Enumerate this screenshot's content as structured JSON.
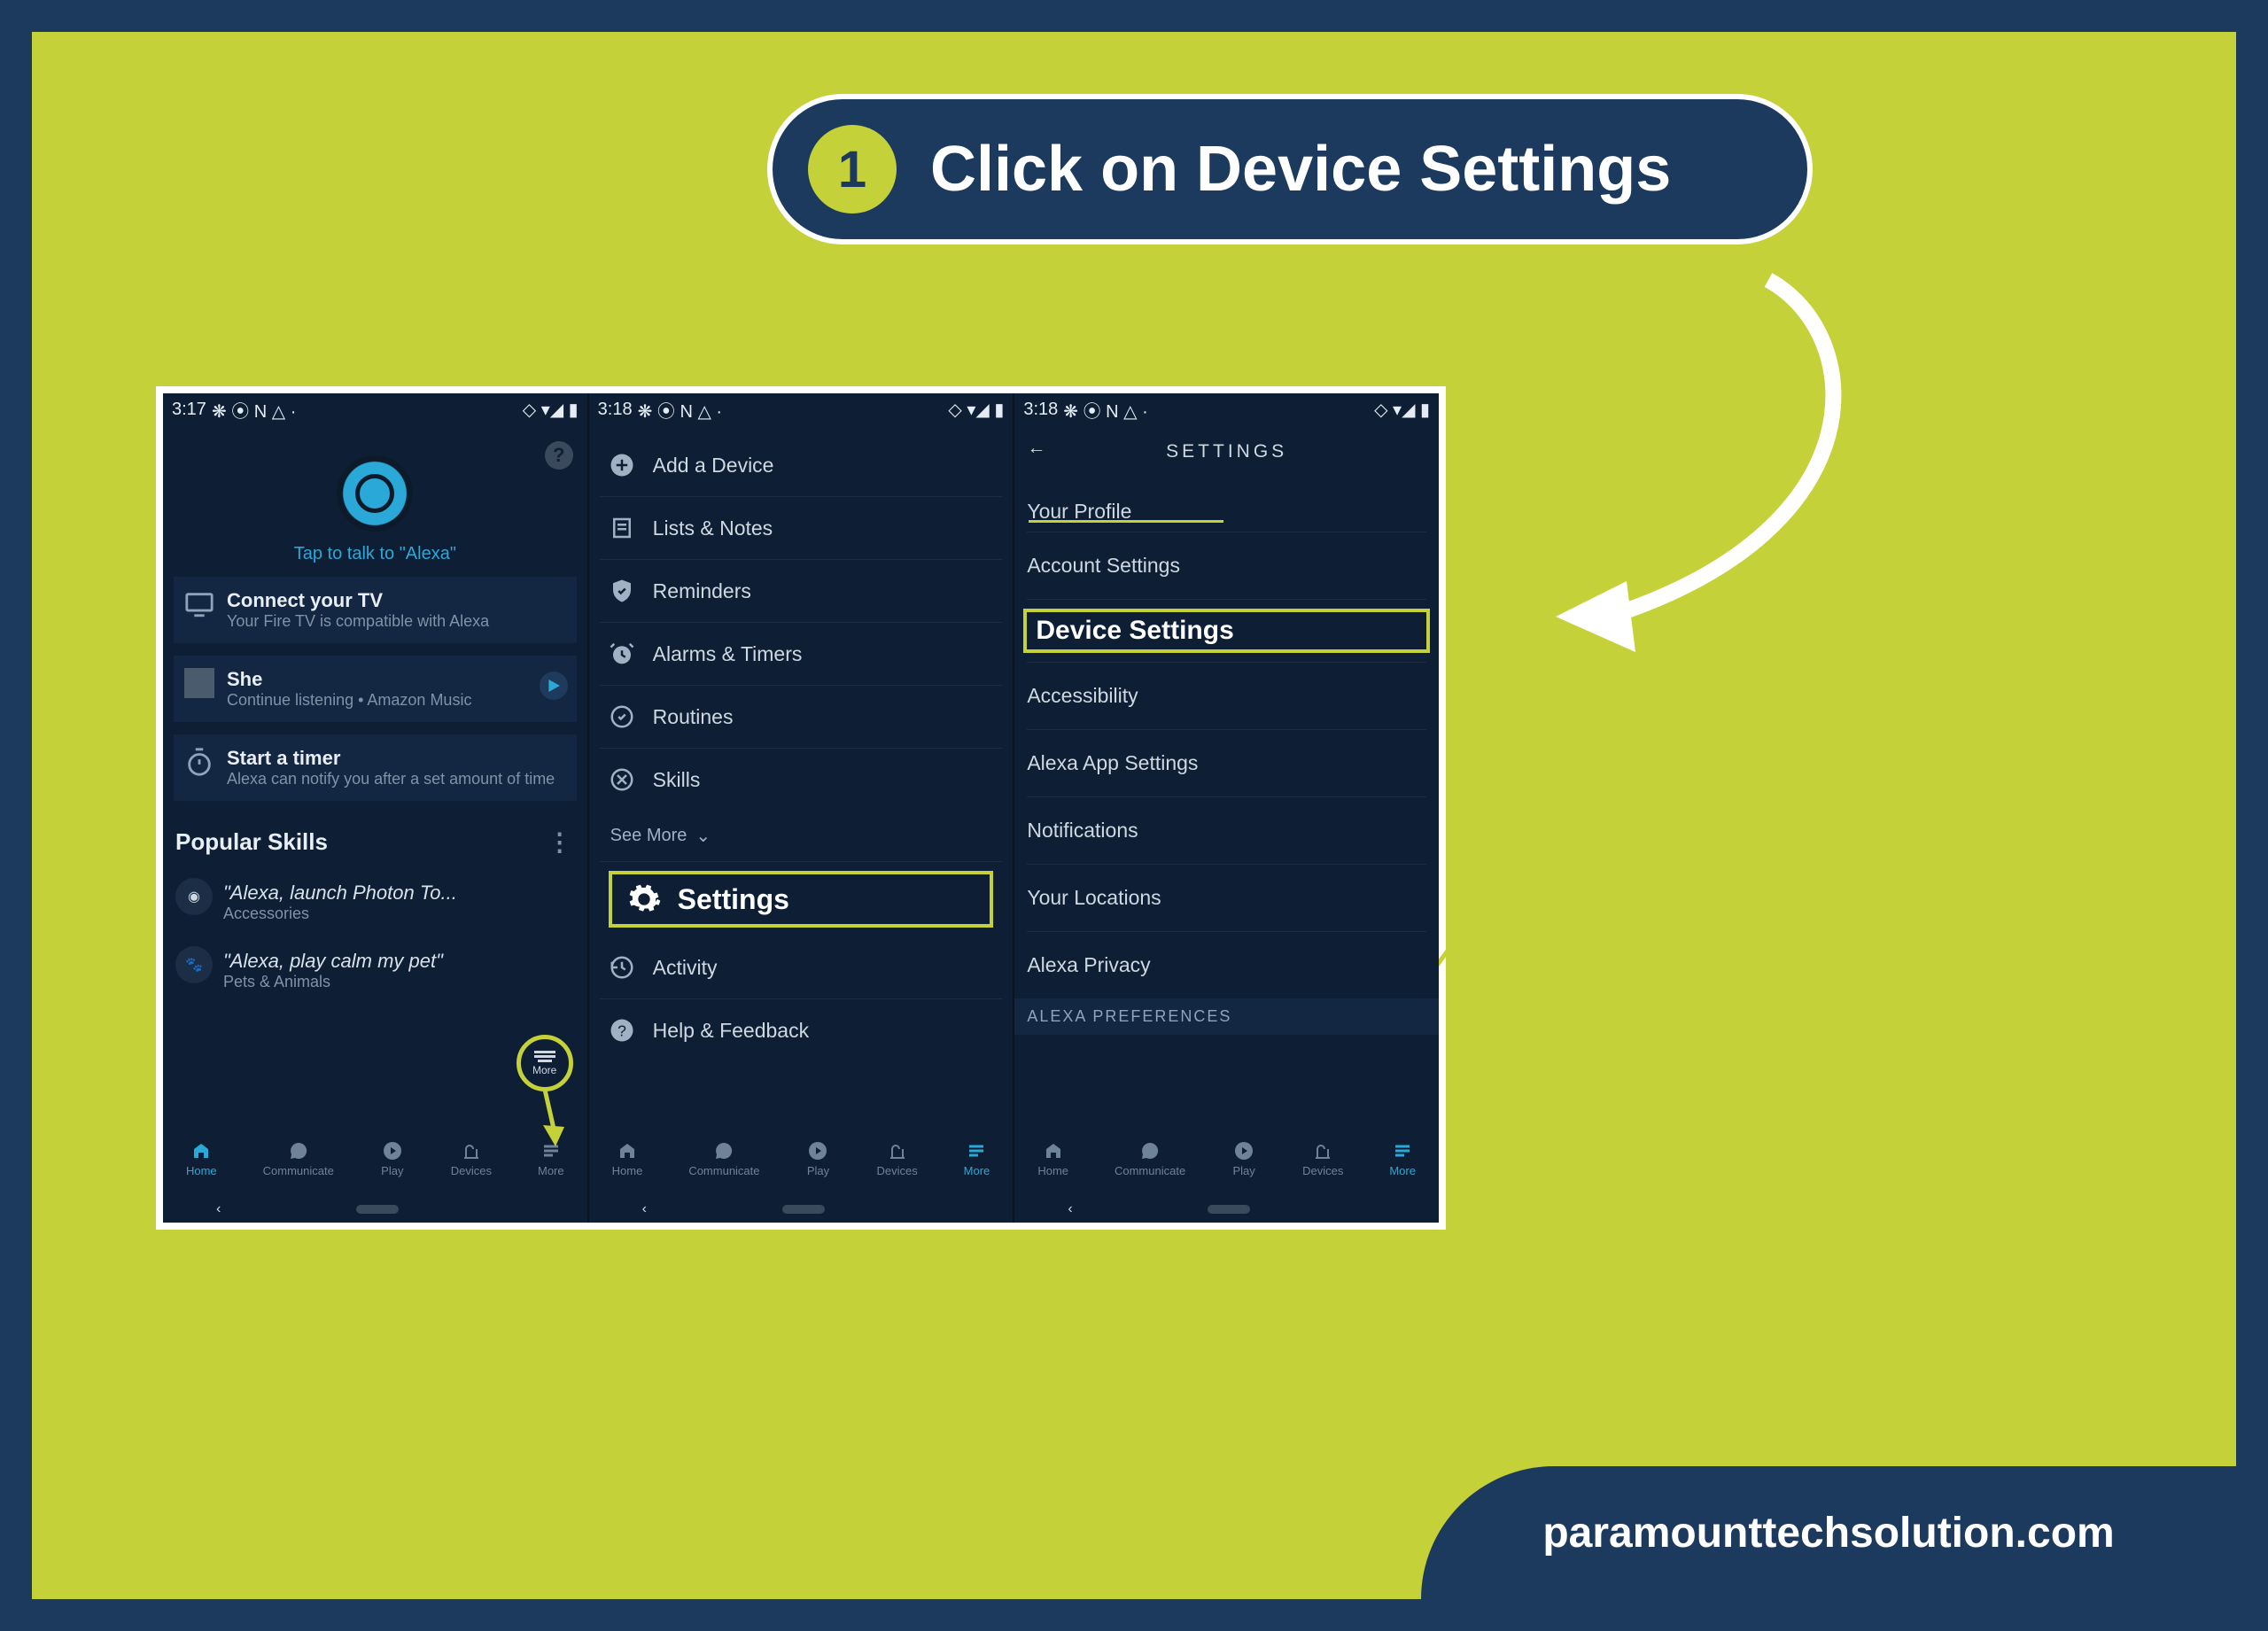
{
  "callout": {
    "step_number": "1",
    "text": "Click on Device Settings"
  },
  "website": "paramounttechsolution.com",
  "screen1": {
    "time": "3:17",
    "status_icons": "❋ ⦿ N △ ·",
    "tap_talk": "Tap to talk to \"Alexa\"",
    "connect": {
      "title": "Connect your TV",
      "sub": "Your Fire TV is compatible with Alexa"
    },
    "she": {
      "title": "She",
      "sub": "Continue listening • Amazon Music"
    },
    "timer": {
      "title": "Start a timer",
      "sub": "Alexa can notify you after a set amount of time"
    },
    "popular_heading": "Popular Skills",
    "skill1": {
      "title": "\"Alexa, launch Photon To...",
      "cat": "Accessories"
    },
    "skill2": {
      "title": "\"Alexa, play calm my pet\"",
      "cat": "Pets & Animals"
    },
    "more_label": "More",
    "nav": {
      "home": "Home",
      "communicate": "Communicate",
      "play": "Play",
      "devices": "Devices",
      "more": "More"
    }
  },
  "screen2": {
    "time": "3:18",
    "status_icons": "❋ ⦿ N △ ·",
    "items": {
      "add_device": "Add a Device",
      "lists": "Lists & Notes",
      "reminders": "Reminders",
      "alarms": "Alarms & Timers",
      "routines": "Routines",
      "skills": "Skills"
    },
    "see_more": "See More",
    "settings": "Settings",
    "activity": "Activity",
    "help": "Help & Feedback"
  },
  "screen3": {
    "time": "3:18",
    "status_icons": "❋ ⦿ N △ ·",
    "header": "SETTINGS",
    "rows": {
      "profile": "Your Profile",
      "account": "Account Settings",
      "device": "Device Settings",
      "accessibility": "Accessibility",
      "app": "Alexa App Settings",
      "notifications": "Notifications",
      "locations": "Your Locations",
      "privacy": "Alexa Privacy",
      "pref_header": "ALEXA PREFERENCES"
    }
  }
}
